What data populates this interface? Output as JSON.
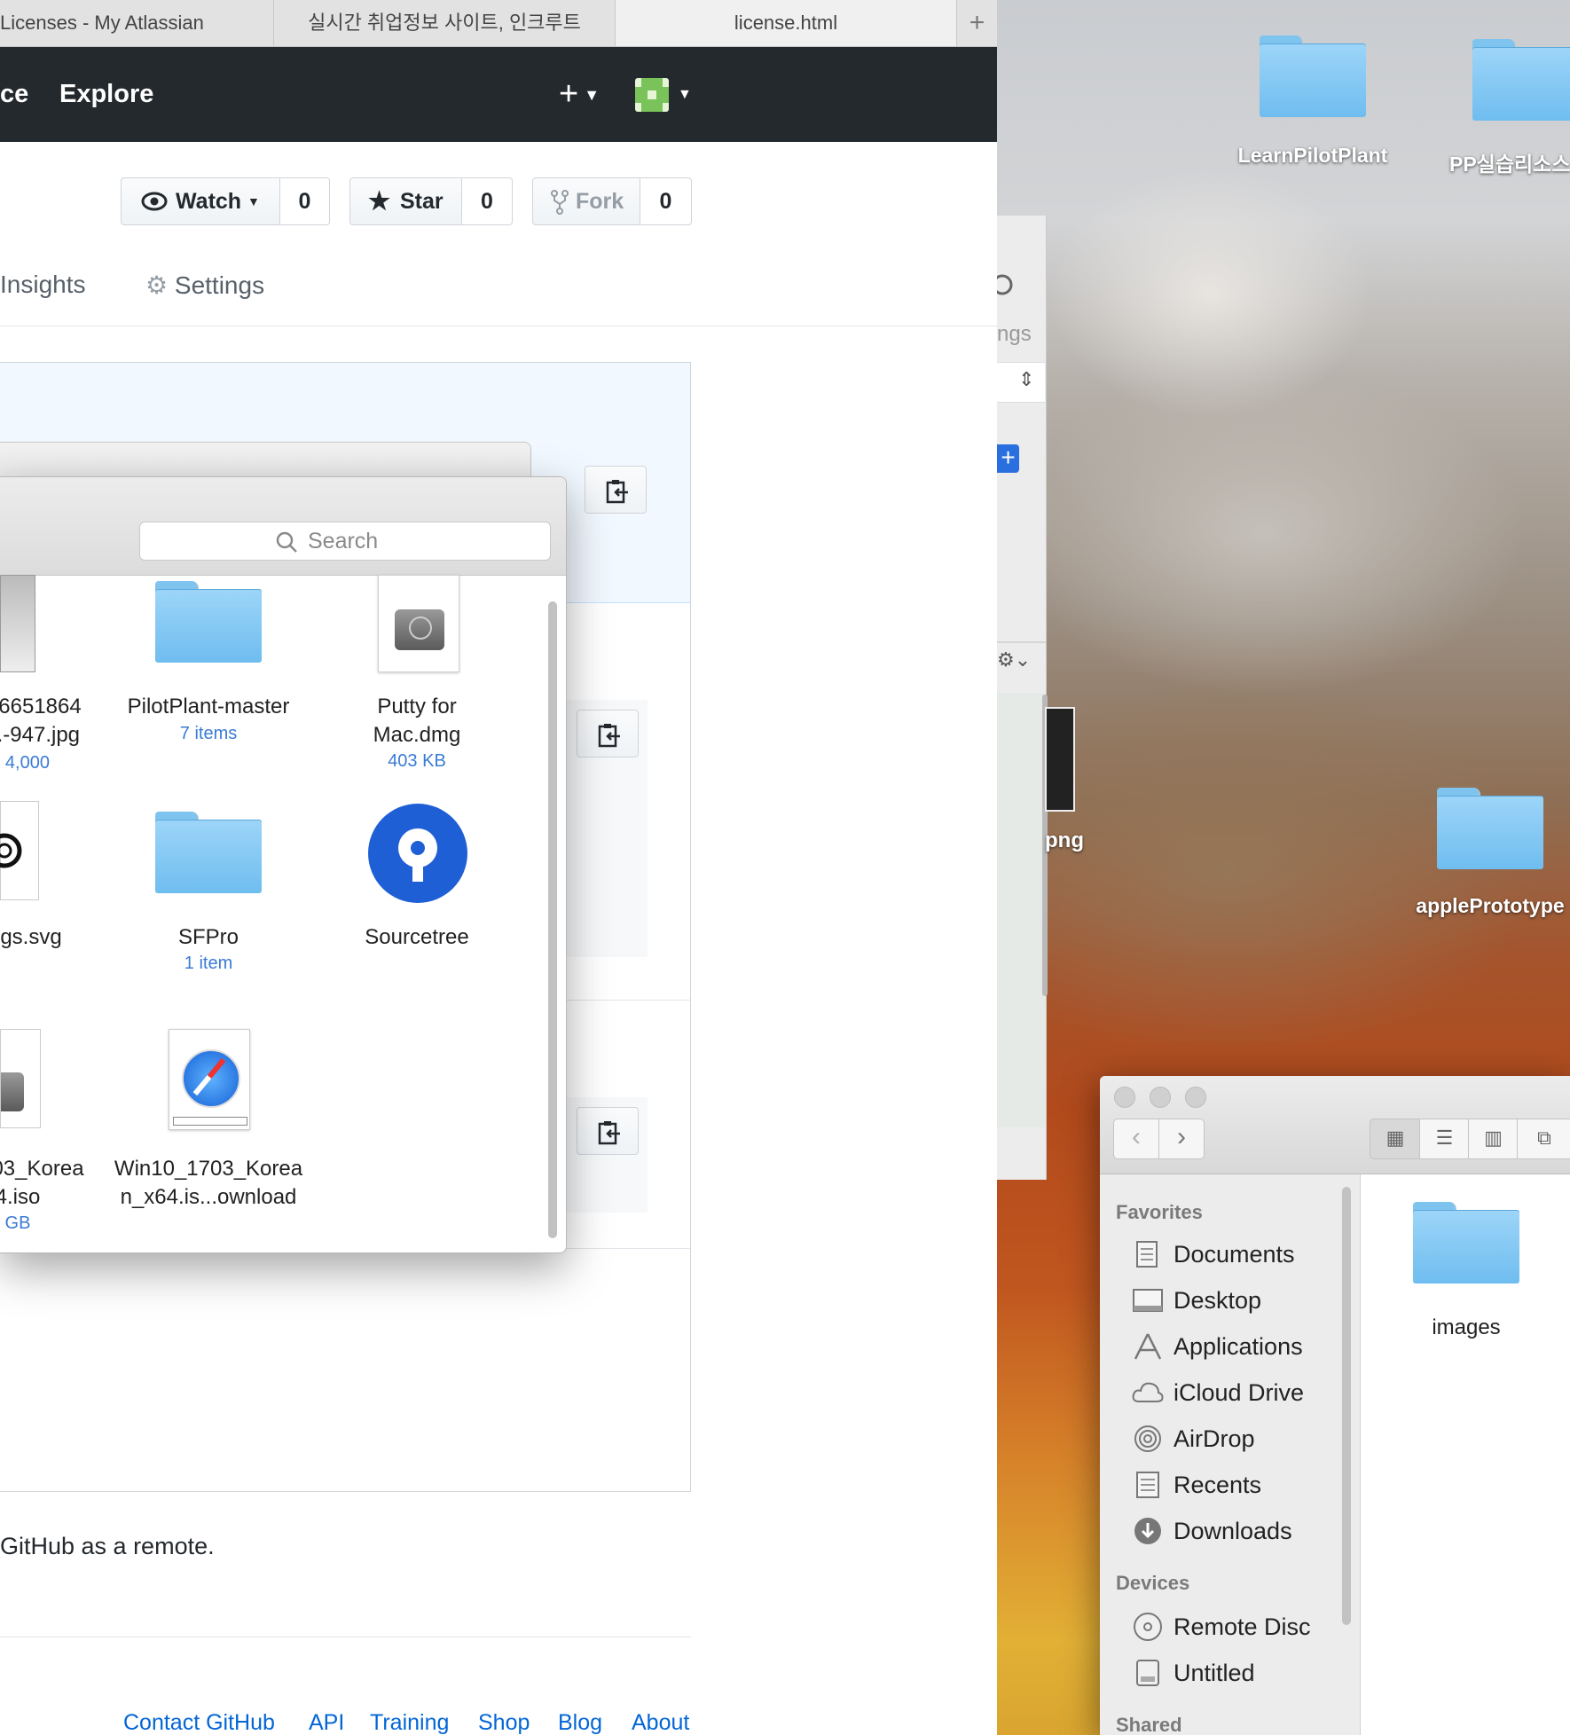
{
  "browser": {
    "tabs": [
      {
        "label": "Licenses - My Atlassian"
      },
      {
        "label": "실시간 취업정보 사이트, 인크루트"
      },
      {
        "label": "license.html"
      }
    ],
    "new_tab_symbol": "+"
  },
  "github": {
    "nav": {
      "item_partial": "ce",
      "explore": "Explore",
      "plus": "+"
    },
    "actions": {
      "watch_label": "Watch",
      "watch_count": "0",
      "star_label": "Star",
      "star_count": "0",
      "fork_label": "Fork",
      "fork_count": "0"
    },
    "tabs": {
      "insights": "Insights",
      "settings": "Settings"
    },
    "remote_text": "GitHub as a remote.",
    "footer": [
      "Contact GitHub",
      "API",
      "Training",
      "Shop",
      "Blog",
      "About"
    ]
  },
  "open_dialog": {
    "search_placeholder": "Search",
    "files": [
      {
        "name_l1": "6651864",
        "name_l2": "..-947.jpg",
        "sub": "⁝ 4,000"
      },
      {
        "name_l1": "PilotPlant-master",
        "name_l2": "",
        "sub": "7 items"
      },
      {
        "name_l1": "Putty for",
        "name_l2": "Mac.dmg",
        "sub": "403 KB"
      },
      {
        "name_l1": "gs.svg",
        "name_l2": "",
        "sub": ""
      },
      {
        "name_l1": "SFPro",
        "name_l2": "",
        "sub": "1 item"
      },
      {
        "name_l1": "Sourcetree",
        "name_l2": "",
        "sub": ""
      },
      {
        "name_l1": "03_Korea",
        "name_l2": "4.iso",
        "sub": "GB"
      },
      {
        "name_l1": "Win10_1703_Korea",
        "name_l2": "n_x64.is...ownload",
        "sub": ""
      }
    ]
  },
  "back_window": {
    "partial_label": "ngs",
    "partial_file": "png"
  },
  "desktop": {
    "icons": [
      {
        "label": "LearnPilotPlant"
      },
      {
        "label": "PP실습리소스"
      },
      {
        "label": "applePrototype"
      }
    ]
  },
  "finder": {
    "favorites_header": "Favorites",
    "favorites": [
      "Documents",
      "Desktop",
      "Applications",
      "iCloud Drive",
      "AirDrop",
      "Recents",
      "Downloads"
    ],
    "devices_header": "Devices",
    "devices": [
      "Remote Disc",
      "Untitled"
    ],
    "shared_header": "Shared",
    "content": [
      {
        "label": "images"
      }
    ]
  },
  "colors": {
    "github_header": "#24292e",
    "link_blue": "#0366d6",
    "folder_blue": "#7fc4ef",
    "sourcetree_blue": "#1f5fd6"
  }
}
